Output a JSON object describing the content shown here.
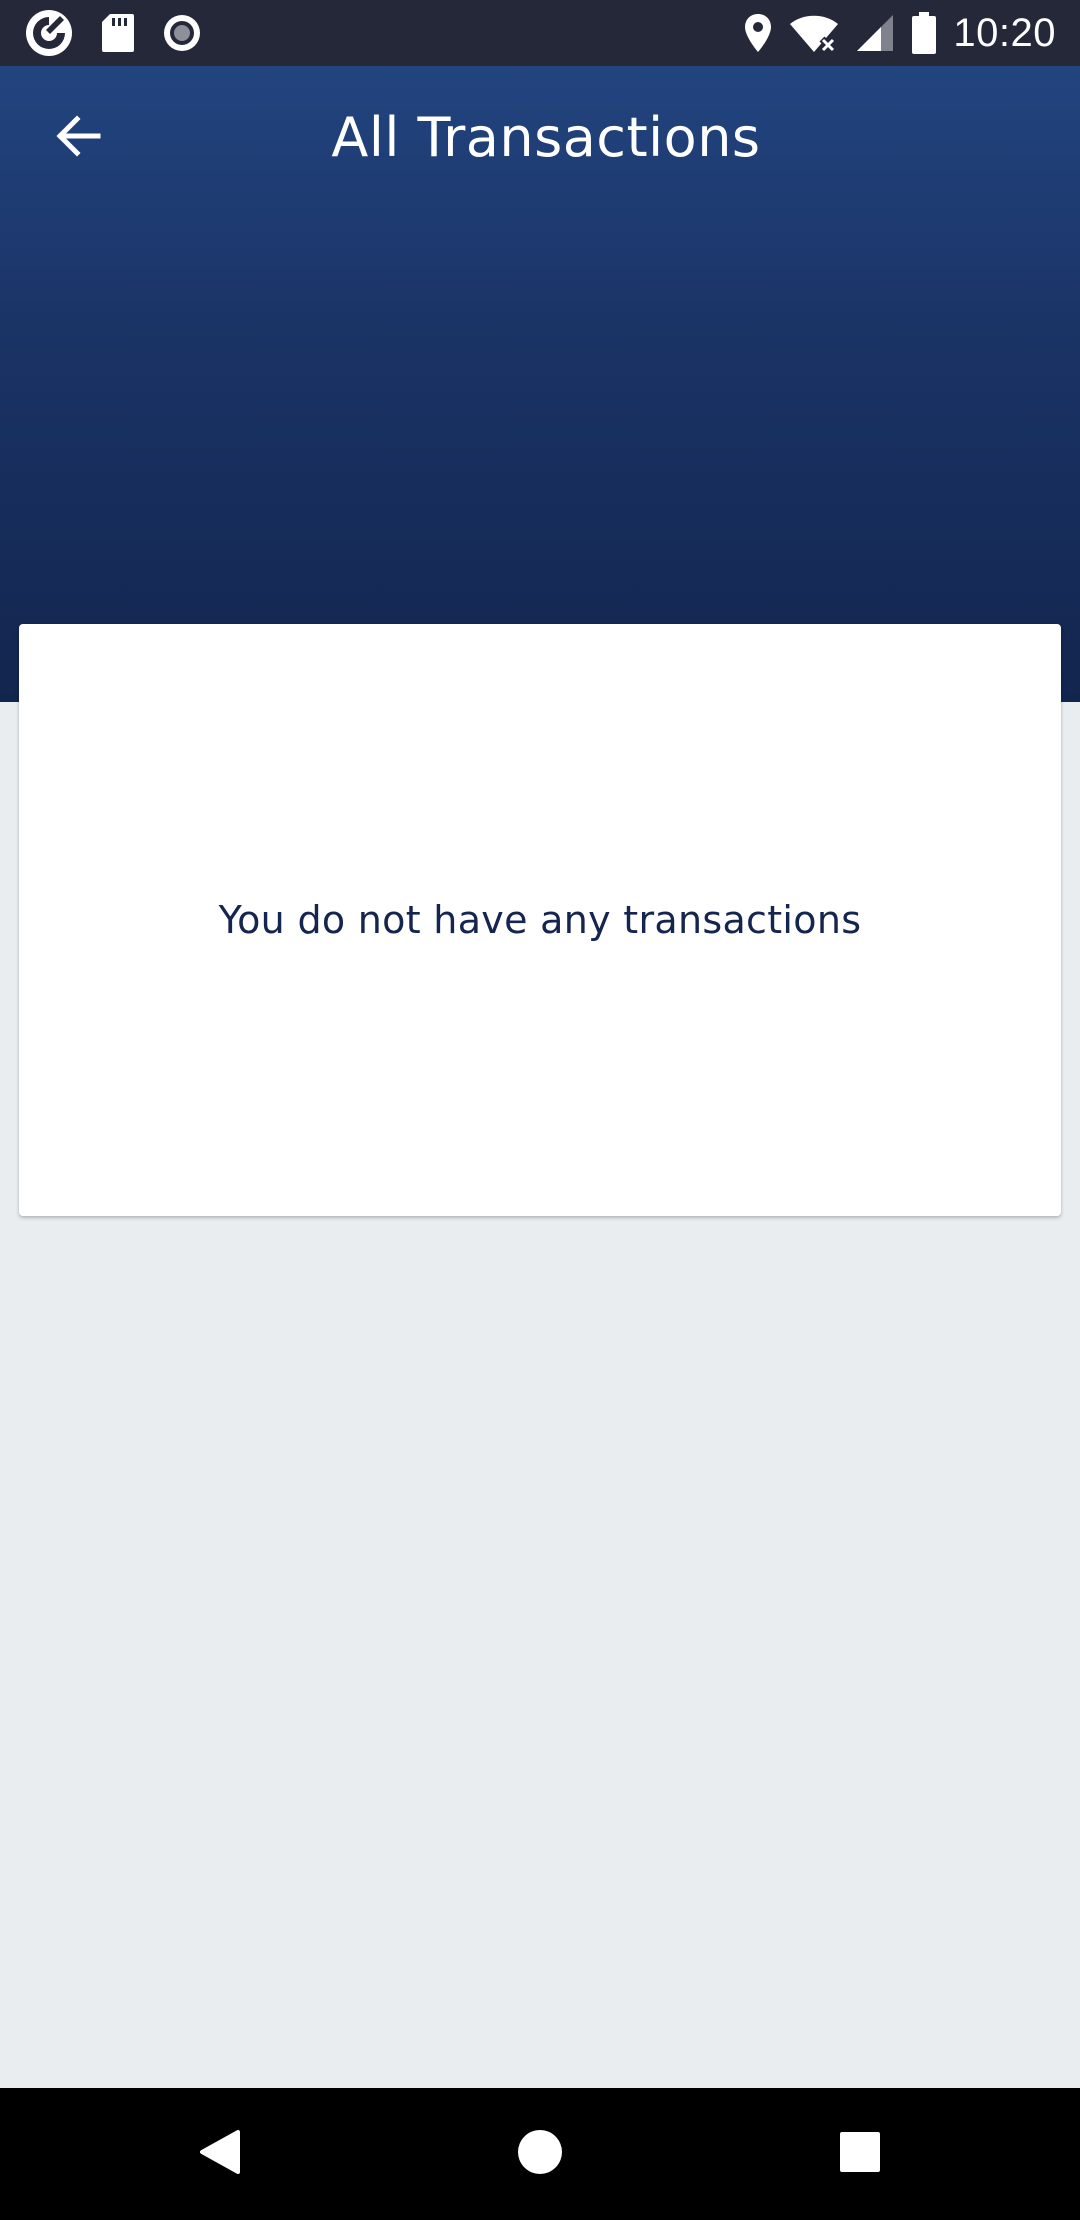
{
  "status_bar": {
    "time": "10:20",
    "left_icons": [
      "app-logo-icon",
      "sd-card-icon",
      "record-icon"
    ],
    "right_icons": [
      "location-icon",
      "wifi-icon",
      "signal-icon",
      "battery-icon"
    ]
  },
  "header": {
    "title": "All Transactions",
    "back_icon": "arrow-left-icon",
    "gradient_top": "#22447f",
    "gradient_bottom": "#12254e"
  },
  "main": {
    "empty_message": "You do not have any transactions",
    "background": "#e9edf0",
    "message_color": "#15254f"
  },
  "nav_bar": {
    "buttons": [
      "back-triangle-icon",
      "home-circle-icon",
      "recents-square-icon"
    ]
  }
}
